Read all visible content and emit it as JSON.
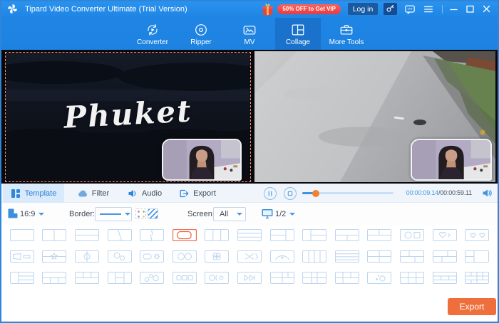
{
  "window": {
    "title": "Tipard Video Converter Ultimate (Trial Version)",
    "promo_badge": "50% OFF to Get VIP",
    "login_label": "Log in"
  },
  "nav": {
    "tabs": [
      {
        "label": "Converter",
        "icon": "converter-icon",
        "active": false
      },
      {
        "label": "Ripper",
        "icon": "ripper-icon",
        "active": false
      },
      {
        "label": "MV",
        "icon": "mv-icon",
        "active": false
      },
      {
        "label": "Collage",
        "icon": "collage-icon",
        "active": true
      },
      {
        "label": "More Tools",
        "icon": "more-tools-icon",
        "active": false
      }
    ]
  },
  "preview": {
    "left_video_text": "Phuket"
  },
  "playback": {
    "tabs": [
      {
        "label": "Template",
        "icon": "template-grid-icon",
        "active": true
      },
      {
        "label": "Filter",
        "icon": "filter-drop-icon",
        "active": false
      },
      {
        "label": "Audio",
        "icon": "audio-speaker-icon",
        "active": false
      },
      {
        "label": "Export",
        "icon": "export-arrow-icon",
        "active": false
      }
    ],
    "current_time": "00:00:09.14",
    "time_separator": "/",
    "total_time": "00:00:59.11",
    "progress_percent": 15
  },
  "toolbar": {
    "aspect_ratio": "16:9",
    "border_label": "Border:",
    "screen_label": "Screen:",
    "screen_value": "All",
    "page_indicator": "1/2"
  },
  "templates": {
    "selected_index": 5,
    "items": [
      "blank",
      "v2",
      "h2",
      "diag",
      "curve",
      "pip",
      "v3",
      "h3",
      "l2r1",
      "l1r2",
      "t1b2",
      "t2b1",
      "circsq",
      "blob",
      "hearts",
      "traps",
      "star",
      "circv",
      "oo",
      "gear",
      "OO",
      "clover",
      "xbr",
      "arch",
      "v4",
      "h4",
      "g22",
      "g22a",
      "g22b",
      "l2big",
      "l1r3",
      "b3",
      "t3",
      "mid",
      "ooo",
      "sq3",
      "obo",
      "arr2",
      "gr3",
      "g32a",
      "mix",
      "dots",
      "g32",
      "h3m",
      "cx"
    ]
  },
  "export": {
    "label": "Export"
  },
  "colors": {
    "titlebar_blue": "#2189e9",
    "active_tab_blue": "#1a72cc",
    "accent_blue": "#2e86d9",
    "badge_red": "#e93a44",
    "orange": "#ee6f3b",
    "template_selected": "#ef6b47",
    "progress_knob": "#f5812f"
  }
}
